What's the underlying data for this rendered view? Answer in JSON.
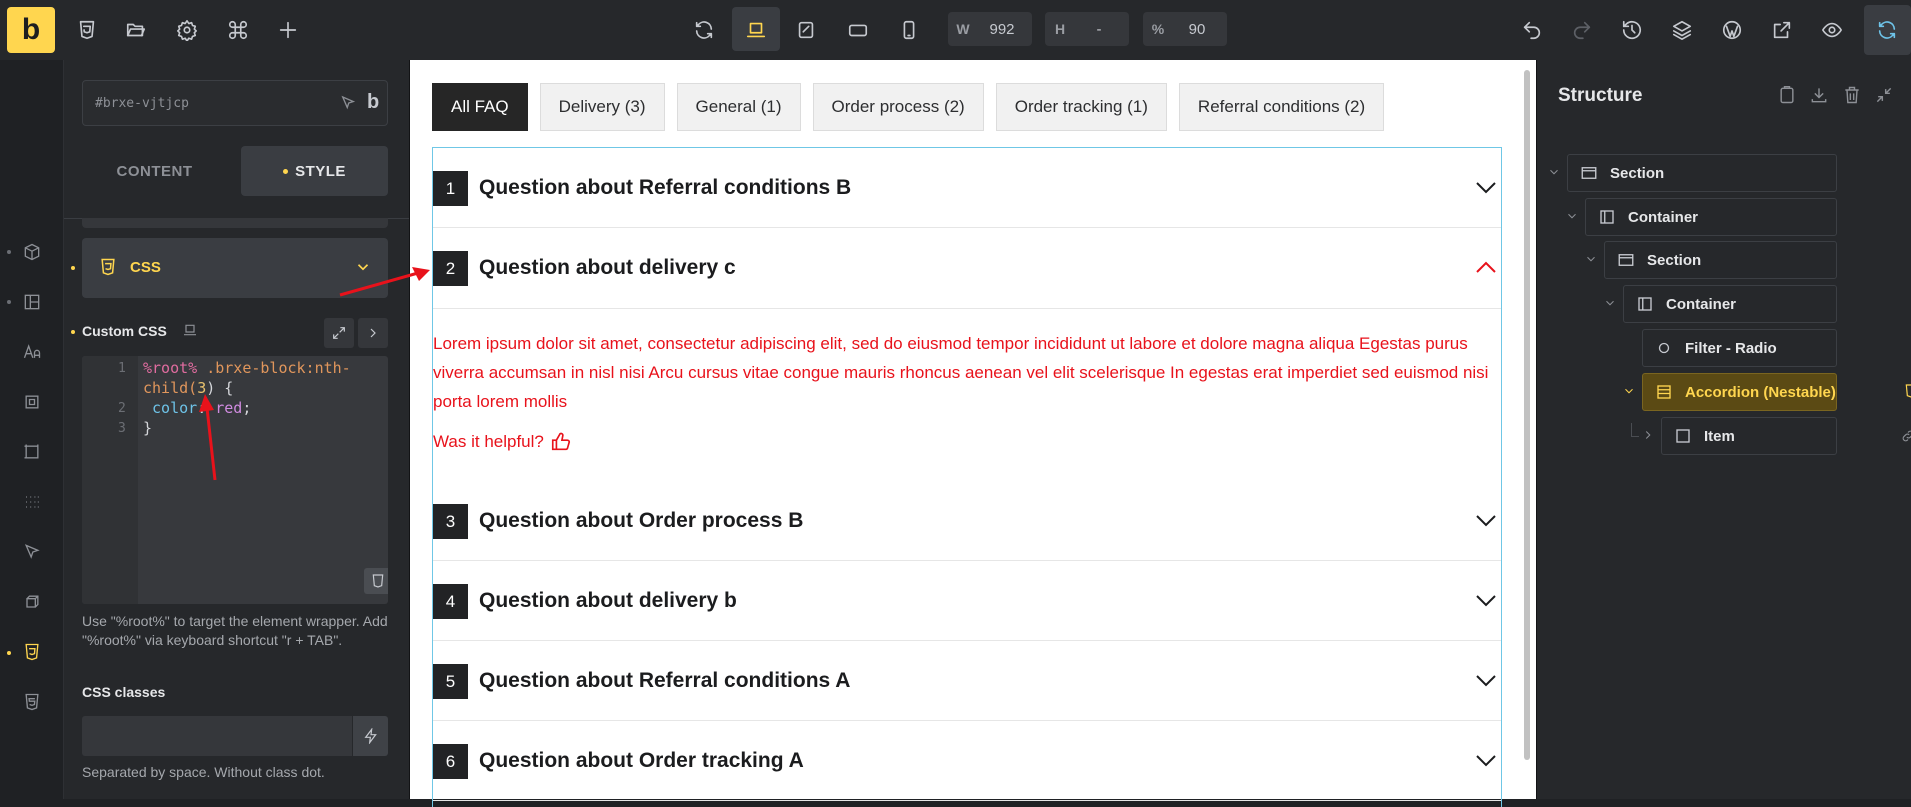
{
  "topbar": {
    "logo": "b",
    "width_label": "W",
    "width_value": "992",
    "height_label": "H",
    "height_value": "-",
    "zoom_label": "%",
    "zoom_value": "90"
  },
  "panel": {
    "element_id": "#brxe-vjtjcp",
    "tab_content": "CONTENT",
    "tab_style": "STYLE",
    "css_section": "CSS",
    "custom_css_label": "Custom CSS",
    "code": {
      "l1_root": "%root%",
      "l1_sel": " .brxe-block:nth-",
      "l1b_sel": "child(",
      "l1b_num": "3",
      "l1b_end": ") {",
      "l2_prop": " color",
      "l2_colon": ": ",
      "l2_val": "red",
      "l2_semi": ";",
      "l3": "}",
      "ln1": "1",
      "ln2": "2",
      "ln3": "3"
    },
    "help_text": "Use \"%root%\" to target the element wrapper. Add \"%root%\" via keyboard shortcut \"r + TAB\".",
    "css_classes_label": "CSS classes",
    "css_classes_help": "Separated by space. Without class dot."
  },
  "canvas": {
    "filter_tabs": [
      "All FAQ",
      "Delivery (3)",
      "General (1)",
      "Order process (2)",
      "Order tracking (1)",
      "Referral conditions (2)"
    ],
    "items": [
      {
        "num": "1",
        "question": "Question about Referral conditions B"
      },
      {
        "num": "2",
        "question": "Question about delivery c"
      },
      {
        "num": "3",
        "question": "Question about Order process B"
      },
      {
        "num": "4",
        "question": "Question about delivery b"
      },
      {
        "num": "5",
        "question": "Question about Referral conditions A"
      },
      {
        "num": "6",
        "question": "Question about Order tracking A"
      }
    ],
    "answer": "Lorem ipsum dolor sit amet, consectetur adipiscing elit, sed do eiusmod tempor incididunt ut labore et dolore magna aliqua Egestas purus viverra accumsan in nisl nisi Arcu cursus vitae congue mauris rhoncus aenean vel elit scelerisque In egestas erat imperdiet sed euismod nisi porta lorem mollis",
    "helpful": "Was it helpful?",
    "answer_color": "#e8121b"
  },
  "structure": {
    "title": "Structure",
    "nodes": [
      {
        "label": "Section"
      },
      {
        "label": "Container"
      },
      {
        "label": "Section"
      },
      {
        "label": "Container"
      },
      {
        "label": "Filter - Radio"
      },
      {
        "label": "Accordion (Nestable)"
      },
      {
        "label": "Item"
      }
    ]
  },
  "colors": {
    "accent": "#ffd64f",
    "selection_border": "#6fc7e6"
  }
}
